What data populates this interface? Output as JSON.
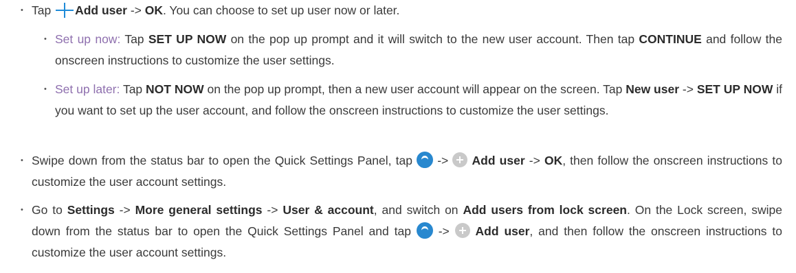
{
  "bullet_char": "•",
  "colors": {
    "text": "#3a3a3a",
    "accent": "#8e6fae",
    "plus_icon": "#1e8ad8",
    "user_icon": "#2888cf",
    "add_icon": "#c9c9c9"
  },
  "icons": {
    "plus": "plus-icon",
    "user": "user-avatar-icon",
    "add": "add-circle-icon"
  },
  "step1": {
    "tap": "Tap",
    "add_user": "Add user",
    "arrow": "->",
    "ok": "OK",
    "rest": ". You can choose to set up user now or later."
  },
  "sub1": {
    "label": "Set up now:",
    "tap": "Tap",
    "setup_now": "SET UP NOW",
    "mid": "on the pop up prompt and it will switch to the new user account. Then tap",
    "continue": "CONTINUE",
    "rest": "and follow the onscreen instructions to customize the user settings."
  },
  "sub2": {
    "label": "Set up later:",
    "tap": "Tap",
    "not_now": "NOT NOW",
    "mid": "on the pop up prompt, then a new user account will appear on the screen. Tap",
    "new_user": "New user",
    "arrow": "->",
    "setup_now": "SET UP NOW",
    "rest": "if you want to set up the user account, and follow the onscreen instructions to customize the user settings."
  },
  "step2": {
    "pre": "Swipe down from the status bar to open the Quick Settings Panel, tap",
    "arrow": "->",
    "add_user": "Add user",
    "arrow2": "->",
    "ok": "OK",
    "rest": ", then follow the onscreen instructions to customize the user account settings."
  },
  "step3": {
    "go": "Go to",
    "settings": "Settings",
    "arrow1": "->",
    "more": "More general settings",
    "arrow2": "->",
    "user_account": "User & account",
    "mid": ", and switch on",
    "add_lock": "Add users from lock screen",
    "mid2": ". On the Lock screen, swipe down from the status bar to open the Quick Settings Panel and tap",
    "arrow3": "->",
    "add_user": "Add user",
    "rest": ", and then follow the onscreen instructions to customize the user account settings."
  }
}
